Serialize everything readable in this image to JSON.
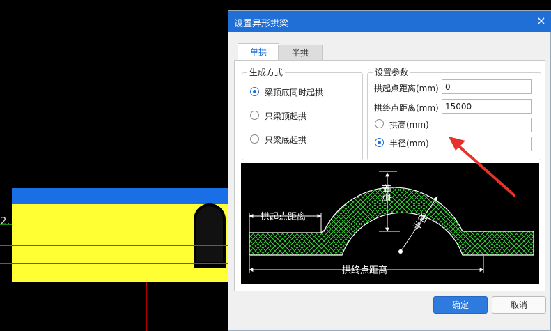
{
  "canvas": {
    "side_label": "2."
  },
  "dialog": {
    "title": "设置异形拱梁",
    "close_label": "×",
    "tabs": [
      {
        "label": "单拱"
      },
      {
        "label": "半拱"
      }
    ],
    "generation": {
      "legend": "生成方式",
      "options": [
        {
          "label": "梁顶底同时起拱",
          "selected": true
        },
        {
          "label": "只梁顶起拱",
          "selected": false
        },
        {
          "label": "只梁底起拱",
          "selected": false
        }
      ]
    },
    "params": {
      "legend": "设置参数",
      "start_distance_label": "拱起点距离(mm)",
      "start_distance_value": "0",
      "end_distance_label": "拱终点距离(mm)",
      "end_distance_value": "15000",
      "height_label": "拱高(mm)",
      "height_value": "",
      "height_selected": false,
      "radius_label": "半径(mm)",
      "radius_value": "",
      "radius_selected": true
    },
    "diagram": {
      "start_label": "拱起点距离",
      "end_label": "拱终点距离",
      "height_label": "拱高",
      "radius_label": "半径"
    },
    "ok_label": "确定",
    "cancel_label": "取消"
  },
  "colors": {
    "accent": "#1f6fd6",
    "hatch": "#39d639",
    "annotation_arrow": "#e8312a"
  }
}
